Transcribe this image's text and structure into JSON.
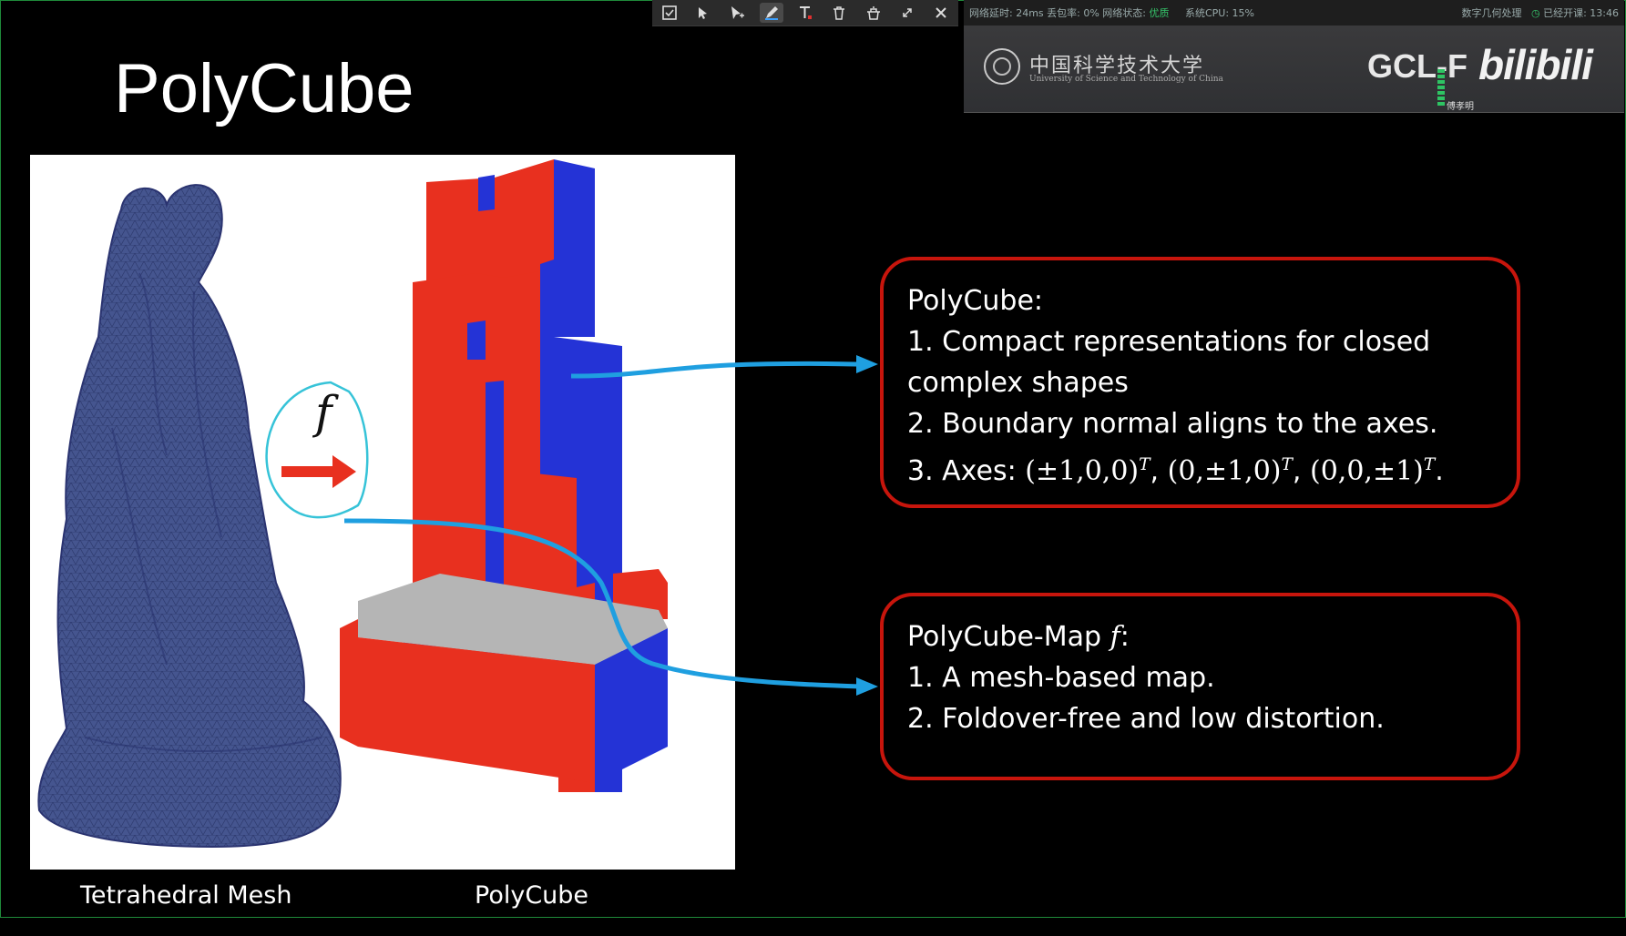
{
  "toolbar": {
    "tools": [
      "checkbox-icon",
      "magic-pointer-icon",
      "pointer-icon",
      "pen-icon",
      "text-icon",
      "trash-icon",
      "clear-icon",
      "collapse-icon",
      "close-icon"
    ]
  },
  "status": {
    "network": "网络延时: 24ms  丢包率: 0%  网络状态:",
    "network_quality": "优质",
    "cpu": "系统CPU: 15%",
    "course": "数字几何处理",
    "elapsed": "已经开课: 13:46"
  },
  "overlay": {
    "university": "中国科学技术大学",
    "university_en": "University of Science and Technology of China",
    "lab": "GCL-F",
    "platform": "bilibili",
    "speaker": "傅孝明"
  },
  "slide": {
    "title": "PolyCube",
    "captions": {
      "left": "Tetrahedral Mesh",
      "right": "PolyCube"
    },
    "map_symbol": "f",
    "box1": {
      "heading": "PolyCube:",
      "line1": "1. Compact representations for closed",
      "line2": "complex shapes",
      "line3": "2. Boundary normal aligns to the axes.",
      "line4_prefix": "3. Axes: ",
      "axis1": "(±1,0,0)",
      "axis2": "(0,±1,0)",
      "axis3": "(0,0,±1)",
      "sup": "T",
      "sep": ", ",
      "end": "."
    },
    "box2": {
      "heading": "PolyCube-Map",
      "heading_symbol": "f",
      "heading_colon": ":",
      "line1": "1. A mesh-based map.",
      "line2": "2. Foldover-free and low distortion."
    }
  },
  "colors": {
    "box_border": "#c7150c",
    "arrow_blue": "#1f9fe0",
    "mesh_blue": "#3d4f8a",
    "cube_red": "#e8301f",
    "cube_blue": "#2433d6"
  }
}
